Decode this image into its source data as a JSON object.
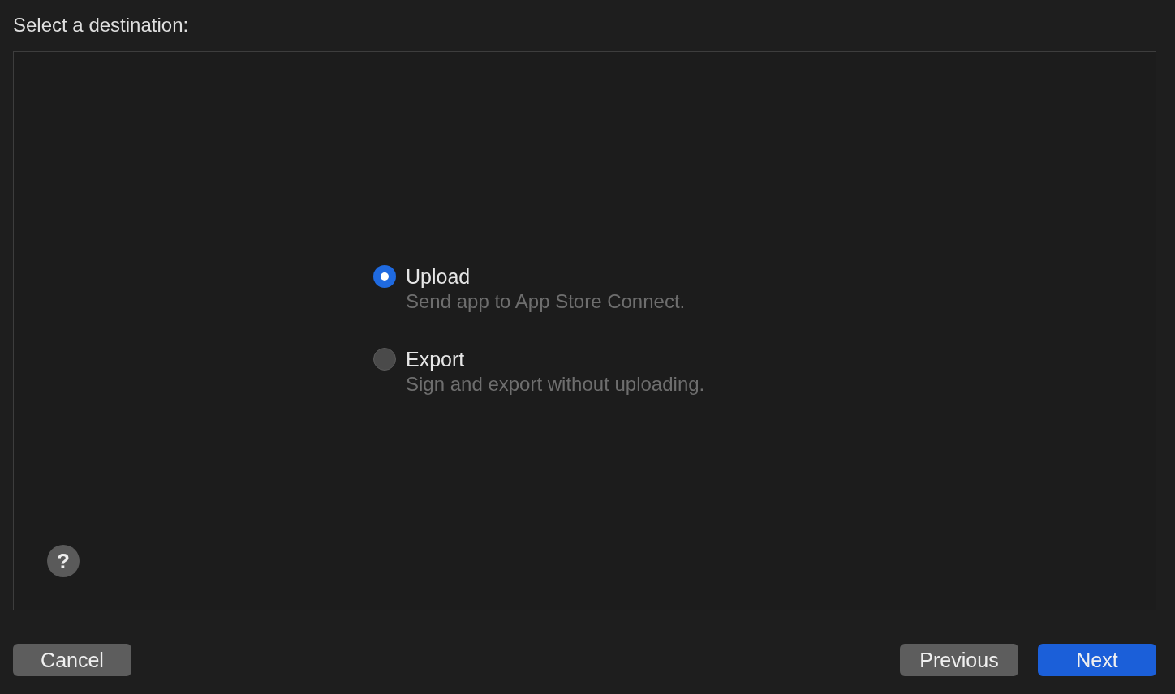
{
  "title": "Select a destination:",
  "options": [
    {
      "label": "Upload",
      "description": "Send app to App Store Connect.",
      "selected": true
    },
    {
      "label": "Export",
      "description": "Sign and export without uploading.",
      "selected": false
    }
  ],
  "help_button": {
    "label": "?"
  },
  "buttons": [
    {
      "label": "Cancel",
      "kind": "plain"
    },
    {
      "label": "Previous",
      "kind": "plain"
    },
    {
      "label": "Next",
      "kind": "default"
    }
  ]
}
